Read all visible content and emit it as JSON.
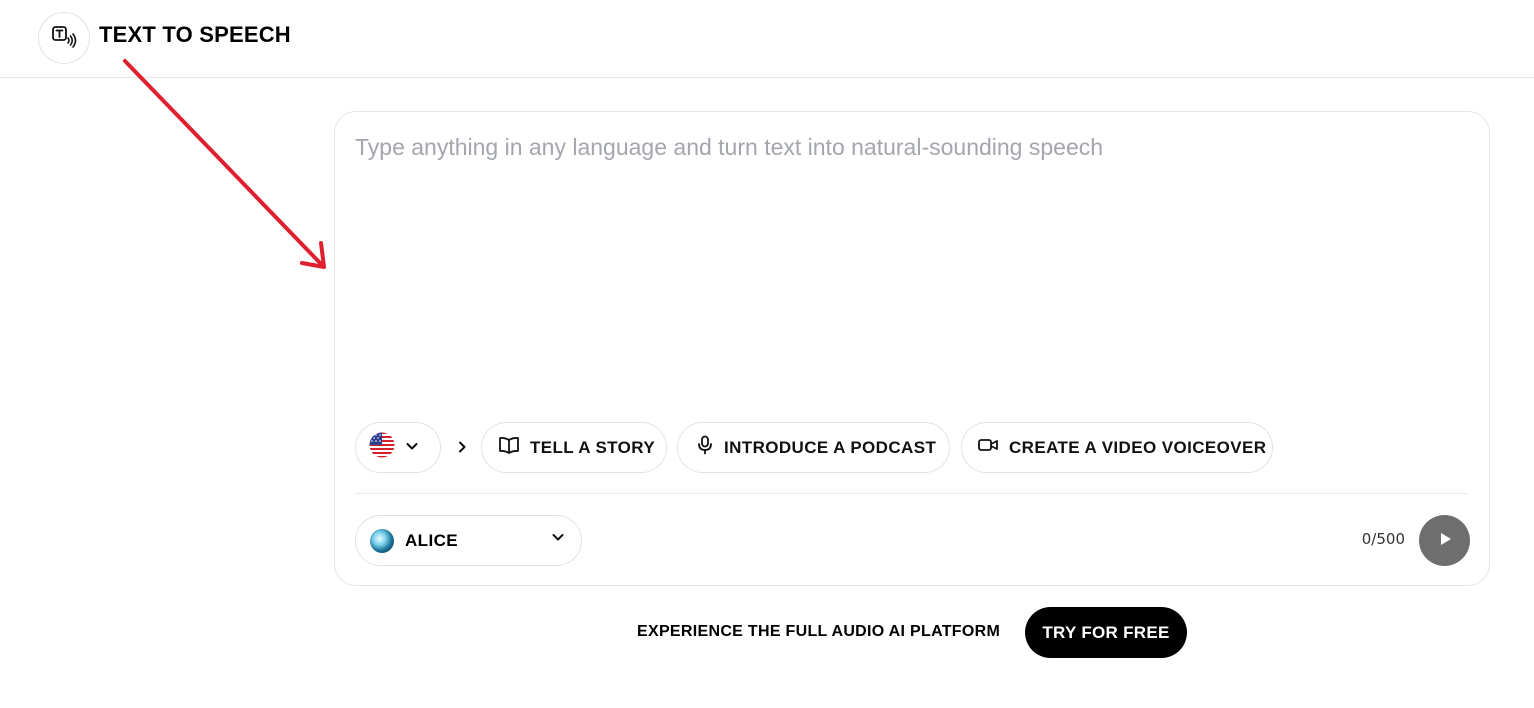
{
  "header": {
    "icon": "text-to-speech-icon",
    "title": "TEXT TO SPEECH"
  },
  "editor": {
    "placeholder": "Type anything in any language and turn text into natural-sounding speech",
    "value": ""
  },
  "toolbar": {
    "language": {
      "icon": "us-flag-icon",
      "selected": "English (US)"
    },
    "more_icon": "chevron-right-icon",
    "suggestions": [
      {
        "label": "TELL A STORY",
        "icon": "book-icon"
      },
      {
        "label": "INTRODUCE A PODCAST",
        "icon": "microphone-icon"
      },
      {
        "label": "CREATE A VIDEO VOICEOVER",
        "icon": "video-camera-icon"
      }
    ]
  },
  "footer": {
    "voice": {
      "name": "ALICE",
      "icon": "voice-avatar"
    },
    "char_count": "0/500",
    "play_icon": "play-icon"
  },
  "promo": {
    "text": "EXPERIENCE THE FULL AUDIO AI PLATFORM",
    "cta_label": "TRY FOR FREE"
  },
  "annotation": {
    "type": "arrow",
    "color": "#e0202f"
  },
  "colors": {
    "play_button": "#6e6e6e",
    "cta_background": "#000000",
    "border": "#e4e4e4",
    "placeholder": "#a3a6ac"
  }
}
